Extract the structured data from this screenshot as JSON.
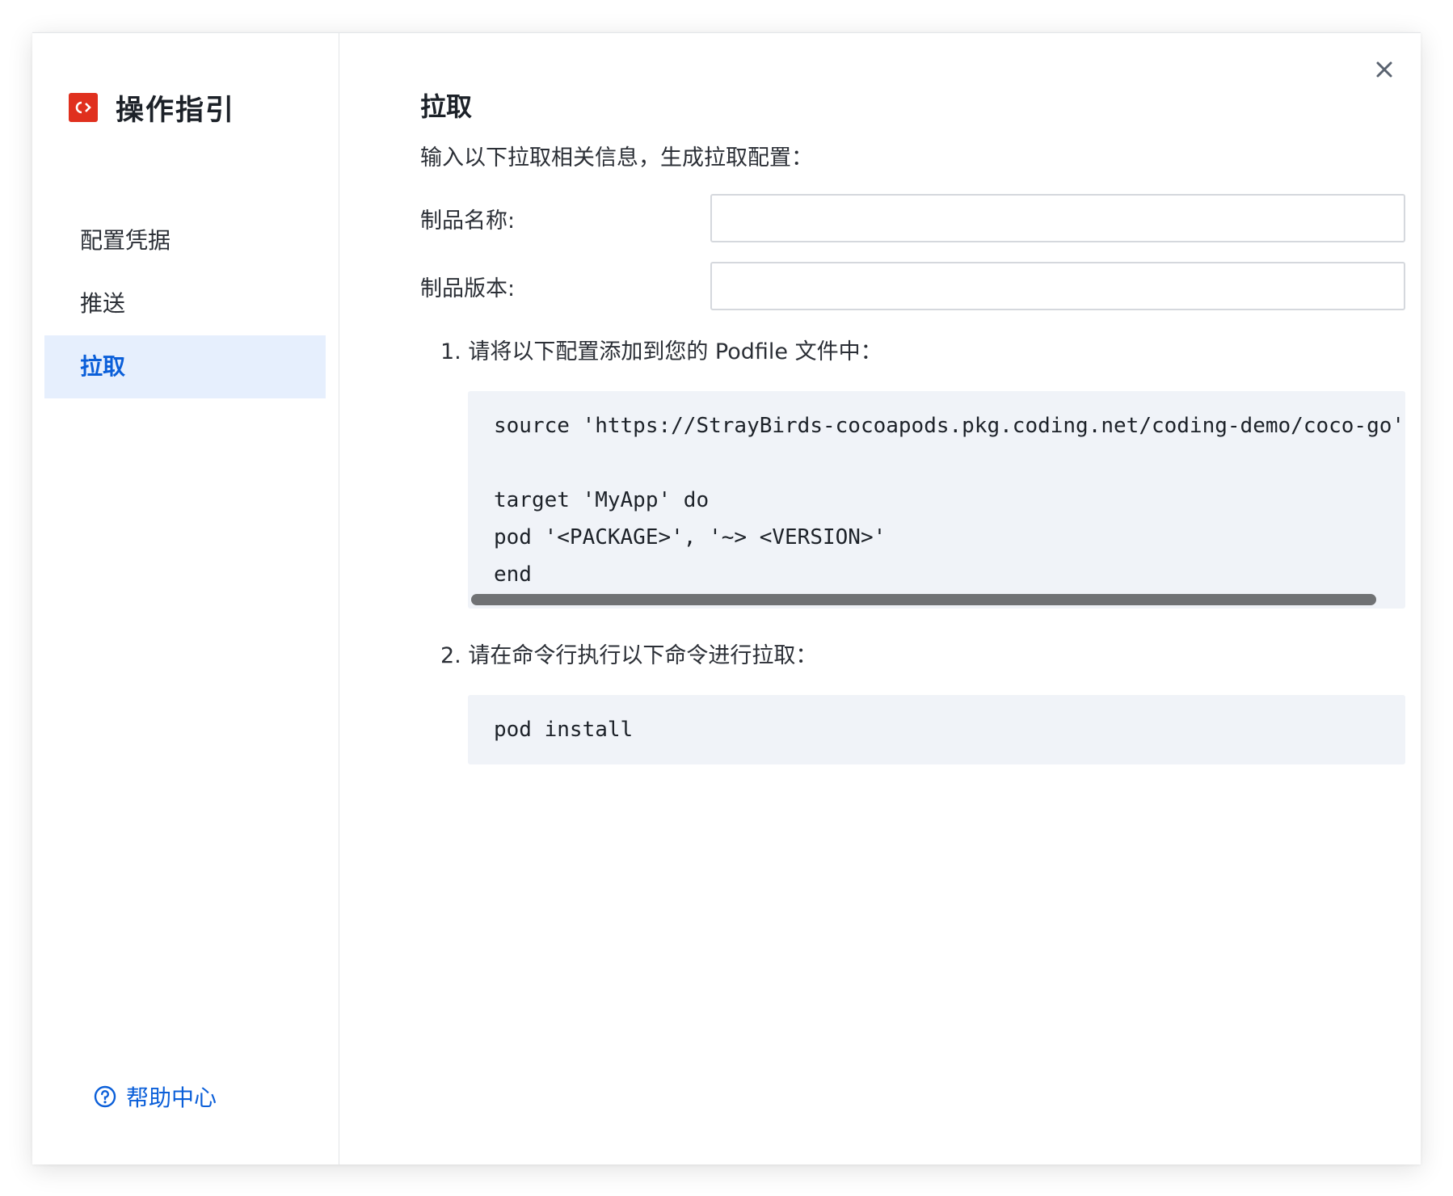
{
  "brand": {
    "logo_text": "C›",
    "title": "操作指引"
  },
  "sidebar": {
    "items": [
      {
        "label": "配置凭据",
        "active": false
      },
      {
        "label": "推送",
        "active": false
      },
      {
        "label": "拉取",
        "active": true
      }
    ],
    "help_label": "帮助中心"
  },
  "main": {
    "title": "拉取",
    "intro": "输入以下拉取相关信息，生成拉取配置：",
    "fields": [
      {
        "label": "制品名称:",
        "value": "",
        "placeholder": ""
      },
      {
        "label": "制品版本:",
        "value": "",
        "placeholder": ""
      }
    ],
    "steps": [
      {
        "text": "1. 请将以下配置添加到您的 Podfile 文件中：",
        "code": [
          "source 'https://StrayBirds-cocoapods.pkg.coding.net/coding-demo/coco-go'",
          "",
          "target 'MyApp' do",
          "pod '<PACKAGE>', '~> <VERSION>'",
          "end"
        ]
      },
      {
        "text": "2. 请在命令行执行以下命令进行拉取：",
        "code": [
          "pod install"
        ]
      }
    ]
  },
  "colors": {
    "accent": "#0b5fd9",
    "active_bg": "#e6effd",
    "logo": "#e0301e",
    "code_bg": "#f0f3f8"
  },
  "icons": {
    "close": "close-icon",
    "help": "question-circle-icon",
    "logo": "coding-logo-icon"
  }
}
